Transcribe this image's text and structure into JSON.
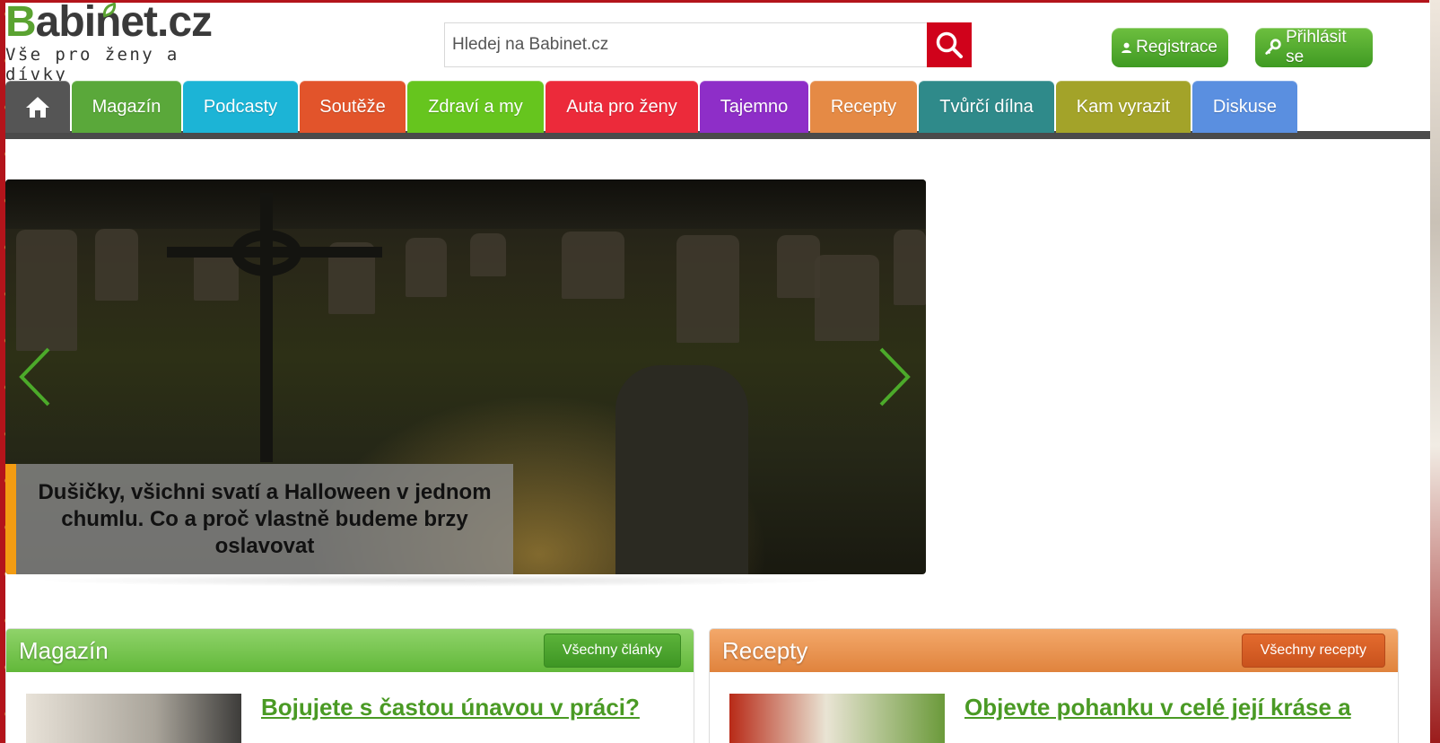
{
  "logo": {
    "brand_first": "B",
    "brand_rest": "abinet.cz",
    "tagline": "Vše pro ženy a dívky"
  },
  "search": {
    "placeholder": "Hledej na Babinet.cz"
  },
  "auth": {
    "register": "Registrace",
    "login": "Přihlásit se"
  },
  "nav": {
    "tabs": [
      {
        "label": "",
        "color": "#555555"
      },
      {
        "label": "Magazín",
        "color": "#5aa83a"
      },
      {
        "label": "Podcasty",
        "color": "#1cb4d6"
      },
      {
        "label": "Soutěže",
        "color": "#e2542b"
      },
      {
        "label": "Zdraví a my",
        "color": "#66c51e"
      },
      {
        "label": "Auta pro ženy",
        "color": "#ec2a3a"
      },
      {
        "label": "Tajemno",
        "color": "#8e2ec8"
      },
      {
        "label": "Recepty",
        "color": "#e58a45"
      },
      {
        "label": "Tvůrčí dílna",
        "color": "#2f8a8a"
      },
      {
        "label": "Kam vyrazit",
        "color": "#a3a329"
      },
      {
        "label": "Diskuse",
        "color": "#5a8fe0"
      }
    ]
  },
  "hero": {
    "caption": "Dušičky, všichni svatí a Halloween v jednom chumlu. Co a proč vlastně budeme brzy oslavovat"
  },
  "sections": {
    "magazin": {
      "title": "Magazín",
      "button": "Všechny články",
      "article": "Bojujete s častou únavou v práci?"
    },
    "recepty": {
      "title": "Recepty",
      "button": "Všechny recepty",
      "article": "Objevte pohanku v celé její kráse a"
    }
  }
}
